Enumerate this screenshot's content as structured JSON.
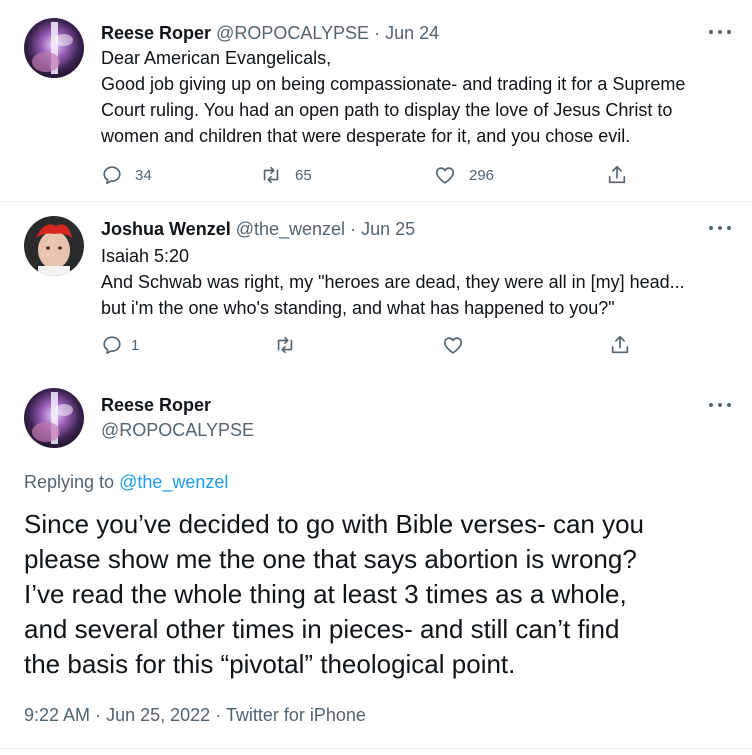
{
  "tweet1": {
    "display_name": "Reese Roper",
    "handle": "@ROPOCALYPSE",
    "separator": "·",
    "date": "Jun 24",
    "lines": [
      "Dear American Evangelicals,",
      "Good job giving up on being compassionate- and trading it for a Supreme",
      "Court ruling. You had an open path to display the love of Jesus Christ to",
      "women and children that were desperate for it, and you chose evil."
    ],
    "reply_count": "34",
    "retweet_count": "65",
    "like_count": "296"
  },
  "tweet2": {
    "display_name": "Joshua Wenzel",
    "handle": "@the_wenzel",
    "separator": "·",
    "date": "Jun 25",
    "lines": [
      "Isaiah 5:20",
      "And Schwab was right, my \"heroes are dead, they were all in [my] head...",
      "but i'm the one who's standing, and what has happened to you?\""
    ],
    "reply_count": "1"
  },
  "main_tweet": {
    "display_name": "Reese Roper",
    "handle": "@ROPOCALYPSE",
    "replying_prefix": "Replying to",
    "replying_handle": "@the_wenzel",
    "lines": [
      "Since you’ve decided to go with Bible verses- can you",
      "please show me the one that says abortion is wrong?",
      "I’ve read the whole thing at least 3 times as a whole,",
      "and several other times in pieces- and still can’t find",
      "the basis for this “pivotal” theological point."
    ],
    "time": "9:22 AM",
    "separator": "·",
    "date": "Jun 25, 2022",
    "separator2": "·",
    "source": "Twitter for iPhone"
  },
  "icons": {
    "reply": "reply-icon",
    "retweet": "retweet-icon",
    "like": "heart-icon",
    "share": "share-icon",
    "more": "more-icon"
  },
  "colors": {
    "text": "#0f1419",
    "muted": "#536471",
    "link": "#1d9bf0",
    "divider": "#eff3f4"
  }
}
